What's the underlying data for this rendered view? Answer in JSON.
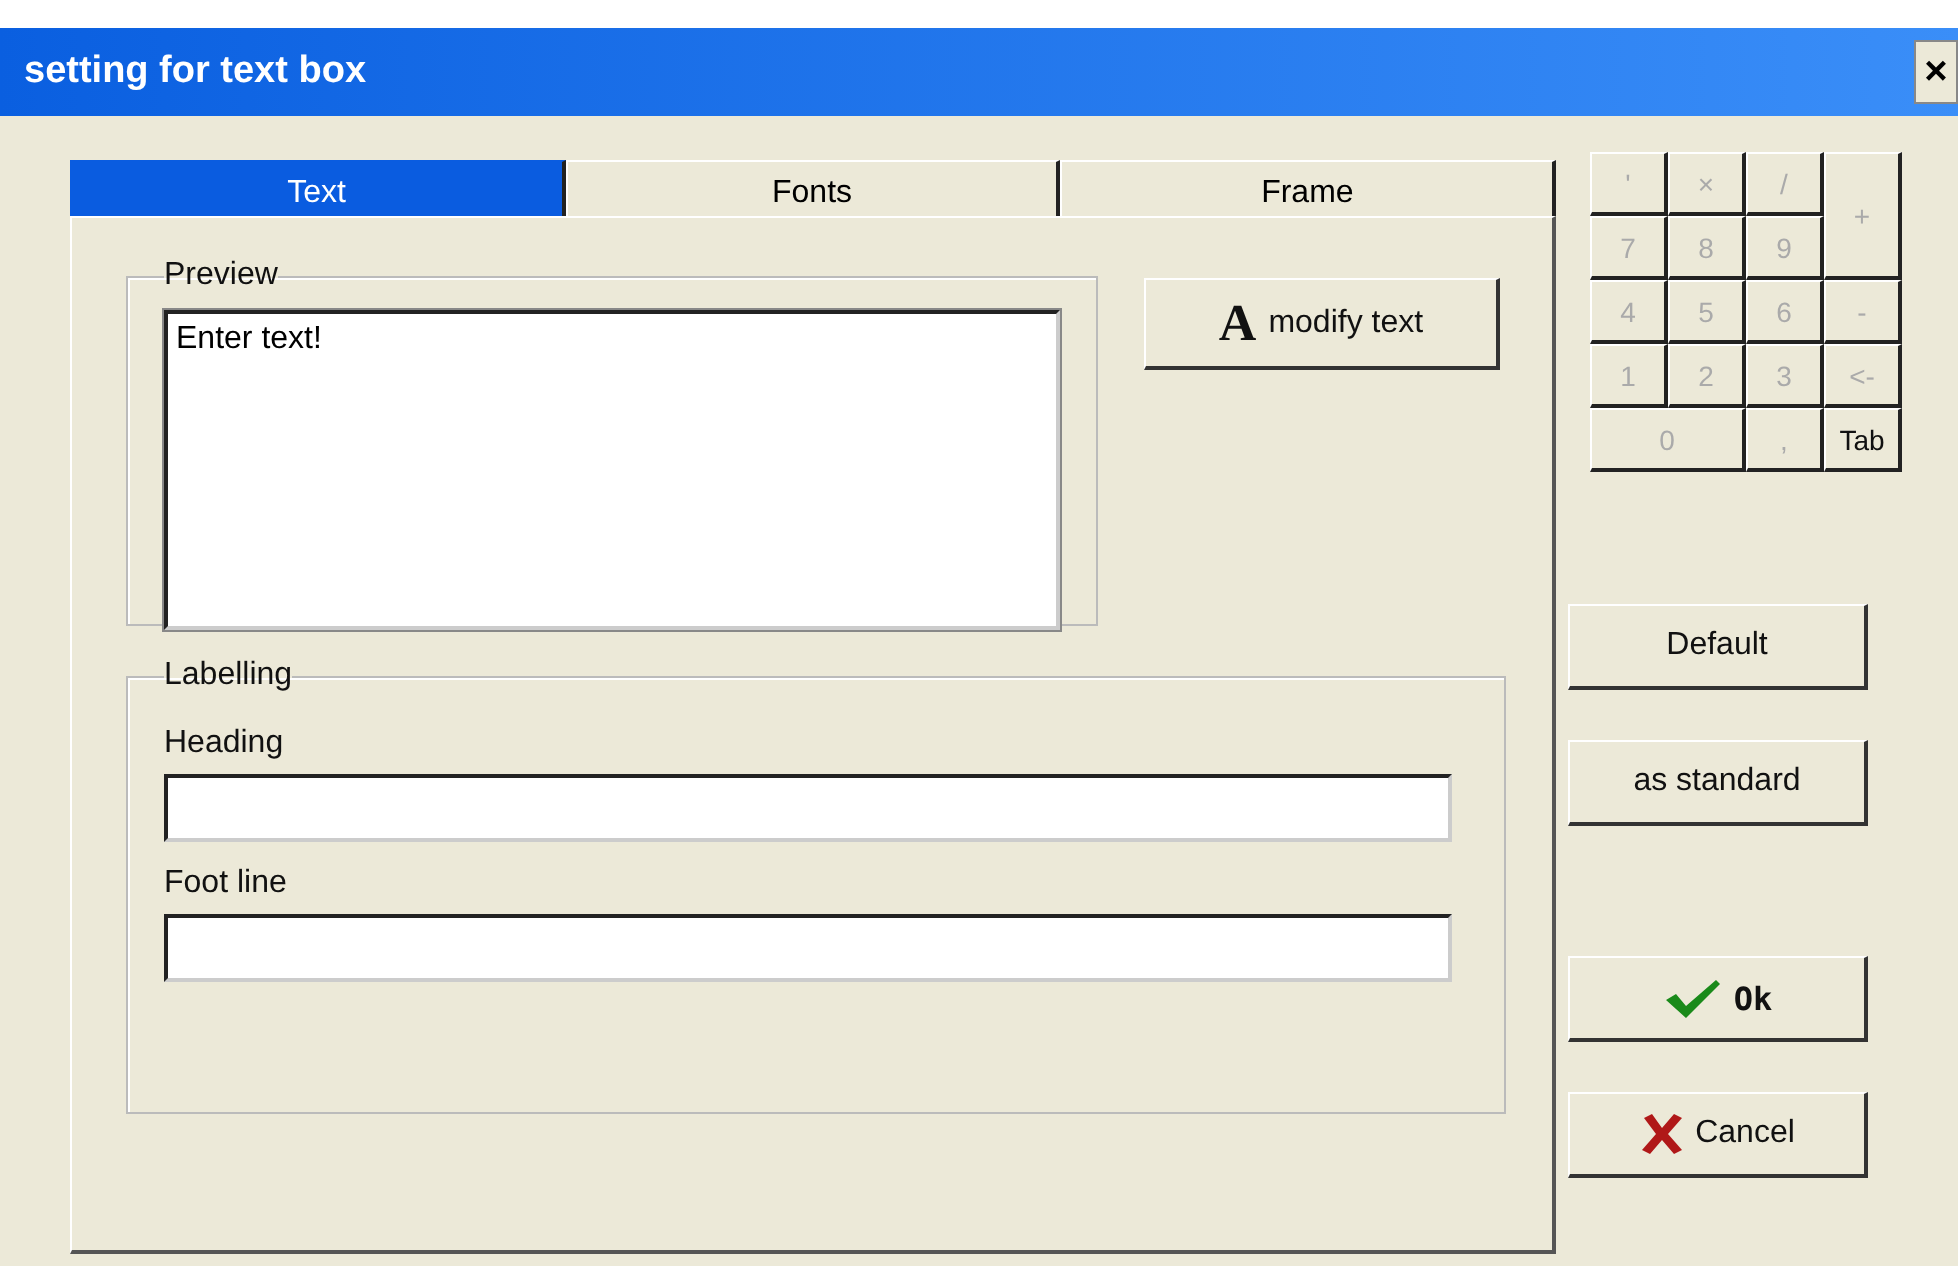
{
  "window": {
    "title": "setting for text box",
    "close": "×"
  },
  "tabs": [
    {
      "label": "Text",
      "selected": true
    },
    {
      "label": "Fonts",
      "selected": false
    },
    {
      "label": "Frame",
      "selected": false
    }
  ],
  "preview": {
    "legend": "Preview",
    "value": "Enter text!"
  },
  "modify_button": {
    "icon": "A",
    "label": "modify text"
  },
  "labelling": {
    "legend": "Labelling",
    "fields": [
      {
        "label": "Heading"
      },
      {
        "label": "Foot line"
      }
    ]
  },
  "keypad": [
    {
      "label": "'",
      "disabled": true
    },
    {
      "label": "×",
      "disabled": true
    },
    {
      "label": "/",
      "disabled": true
    },
    {
      "label": "+",
      "disabled": true,
      "kind": "tall"
    },
    {
      "label": "7",
      "disabled": true
    },
    {
      "label": "8",
      "disabled": true
    },
    {
      "label": "9",
      "disabled": true
    },
    {
      "label": "4",
      "disabled": true
    },
    {
      "label": "5",
      "disabled": true
    },
    {
      "label": "6",
      "disabled": true
    },
    {
      "label": "-",
      "disabled": true
    },
    {
      "label": "1",
      "disabled": true
    },
    {
      "label": "2",
      "disabled": true
    },
    {
      "label": "3",
      "disabled": true
    },
    {
      "label": "<-",
      "disabled": true
    },
    {
      "label": "0",
      "disabled": true,
      "kind": "wide"
    },
    {
      "label": ",",
      "disabled": true
    },
    {
      "label": "Tab",
      "disabled": false
    }
  ],
  "buttons": [
    {
      "label": "Default",
      "kind": "plain"
    },
    {
      "label": "as standard",
      "kind": "plain"
    },
    {
      "label": "Ok",
      "kind": "ok"
    },
    {
      "label": "Cancel",
      "kind": "cancel"
    }
  ]
}
